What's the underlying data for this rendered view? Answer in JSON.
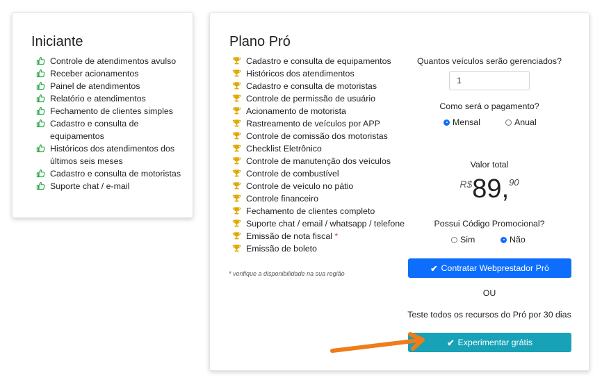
{
  "iniciante": {
    "title": "Iniciante",
    "features": [
      "Controle de atendimentos avulso",
      "Receber acionamentos",
      "Painel de atendimentos",
      "Relatório e atendimentos",
      "Fechamento de clientes simples",
      "Cadastro e consulta de equipamentos",
      "Históricos dos atendimentos dos últimos seis meses",
      "Cadastro e consulta de motoristas",
      "Suporte chat / e-mail"
    ]
  },
  "pro": {
    "title": "Plano Pró",
    "features": [
      "Cadastro e consulta de equipamentos",
      "Históricos dos atendimentos",
      "Cadastro e consulta de motoristas",
      "Controle de permissão de usuário",
      "Acionamento de motorista",
      "Rastreamento de veículos por APP",
      "Controle de comissão dos motoristas",
      "Checklist Eletrônico",
      "Controle de manutenção dos veículos",
      "Controle de combustível",
      "Controle de veículo no pátio",
      "Controle financeiro",
      "Fechamento de clientes completo",
      "Suporte chat / email / whatsapp / telefone",
      "Emissão de nota fiscal",
      "Emissão de boleto"
    ],
    "required_mark": "*",
    "footnote": "* verifique a disponibilidade na sua região"
  },
  "form": {
    "vehicles_label": "Quantos veículos serão gerenciados?",
    "vehicles_value": "1",
    "payment_label": "Como será o pagamento?",
    "payment_options": [
      "Mensal",
      "Anual"
    ],
    "payment_selected": "Mensal",
    "total_label": "Valor total",
    "currency": "R$",
    "price_int": "89,",
    "price_cents": "90",
    "promo_label": "Possui Código Promocional?",
    "promo_options": [
      "Sim",
      "Não"
    ],
    "promo_selected": "Não",
    "contract_button": "Contratar Webprestador Pró",
    "or_label": "OU",
    "trial_text": "Teste todos os recursos do Pró por 30 dias",
    "trial_button": "Experimentar grátis"
  },
  "colors": {
    "thumb_icon": "#28a745",
    "trophy_icon": "#e0a800",
    "primary_button": "#0d6efd",
    "trial_button": "#17a2b8",
    "arrow": "#f07c18"
  },
  "icons": {
    "iniciante_item": "thumbs-up-icon",
    "pro_item": "trophy-icon",
    "button_check": "check-icon",
    "annotation": "arrow-icon"
  }
}
